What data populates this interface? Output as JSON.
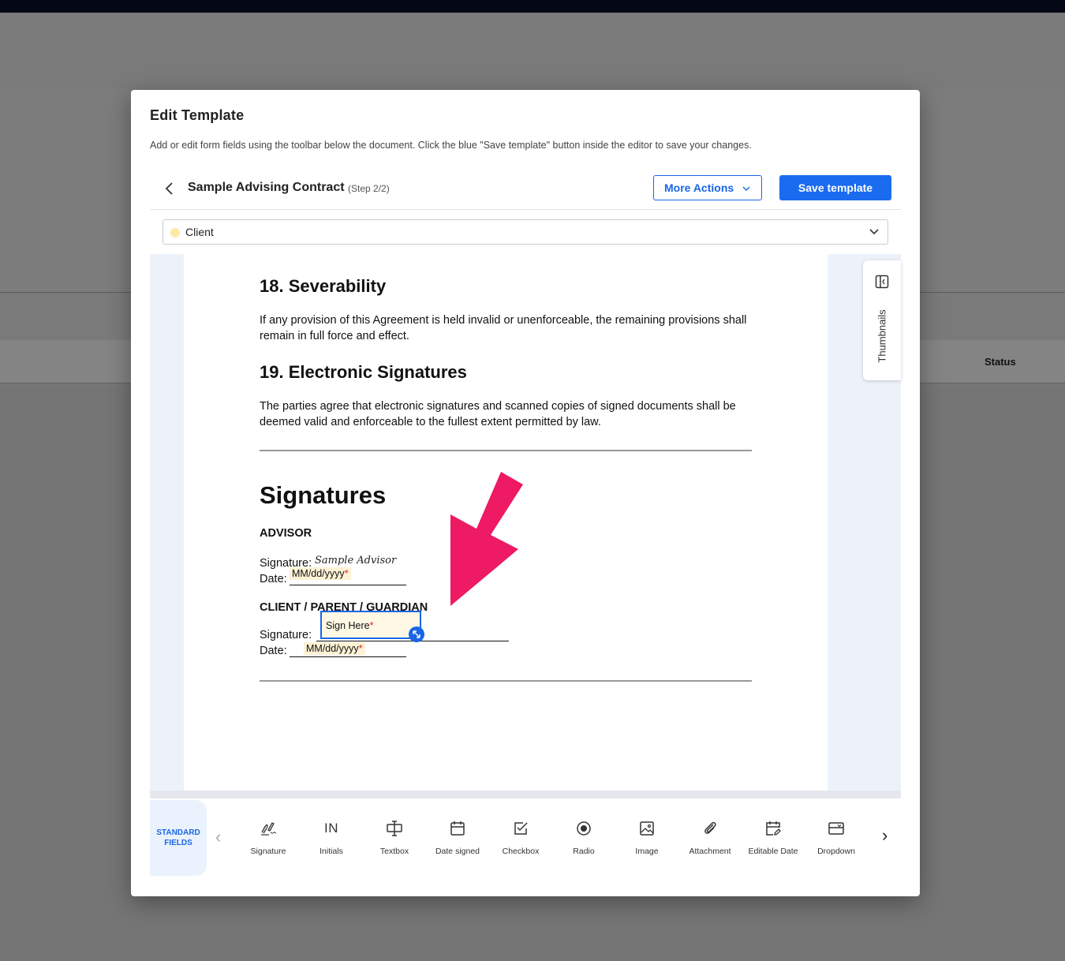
{
  "background": {
    "status_header": "Status"
  },
  "modal": {
    "title": "Edit Template",
    "description": "Add or edit form fields using the toolbar below the document. Click the blue \"Save template\" button inside the editor to save your changes."
  },
  "editor": {
    "document_title": "Sample Advising Contract",
    "step": "(Step 2/2)",
    "more_actions_label": "More Actions",
    "save_label": "Save template",
    "recipient": "Client",
    "recipient_color": "#fde9a6"
  },
  "document": {
    "sec18_heading": "18. Severability",
    "sec18_body": "If any provision of this Agreement is held invalid or unenforceable, the remaining provisions shall remain in full force and effect.",
    "sec19_heading": "19. Electronic Signatures",
    "sec19_body": "The parties agree that electronic signatures and scanned copies of signed documents shall be deemed valid and enforceable to the fullest extent permitted by law.",
    "signatures_heading": "Signatures",
    "advisor_heading": "ADVISOR",
    "signature_label": "Signature:",
    "date_label": "Date:",
    "advisor_signature": "Sample Advisor",
    "date_placeholder": "MM/dd/yyyy",
    "client_heading": "CLIENT / PARENT / GUARDIAN",
    "sign_here": "Sign Here",
    "required_mark": "*"
  },
  "side_panel": {
    "thumbnails_label": "Thumbnails"
  },
  "toolbar": {
    "standard_fields_tab": "STANDARD FIELDS",
    "tools": [
      {
        "label": "Signature",
        "icon": "signature-icon"
      },
      {
        "label": "Initials",
        "icon": "initials-icon",
        "glyph": "IN"
      },
      {
        "label": "Textbox",
        "icon": "textbox-icon"
      },
      {
        "label": "Date signed",
        "icon": "calendar-icon"
      },
      {
        "label": "Checkbox",
        "icon": "checkbox-icon"
      },
      {
        "label": "Radio",
        "icon": "radio-icon"
      },
      {
        "label": "Image",
        "icon": "image-icon"
      },
      {
        "label": "Attachment",
        "icon": "paperclip-icon"
      },
      {
        "label": "Editable Date",
        "icon": "edit-calendar-icon"
      },
      {
        "label": "Dropdown",
        "icon": "dropdown-icon"
      }
    ]
  },
  "annotation": {
    "arrow_color": "#ee1a63"
  },
  "colors": {
    "accent": "#1a66e6",
    "field_highlight": "#fdf2d5",
    "required": "#e0262b"
  }
}
